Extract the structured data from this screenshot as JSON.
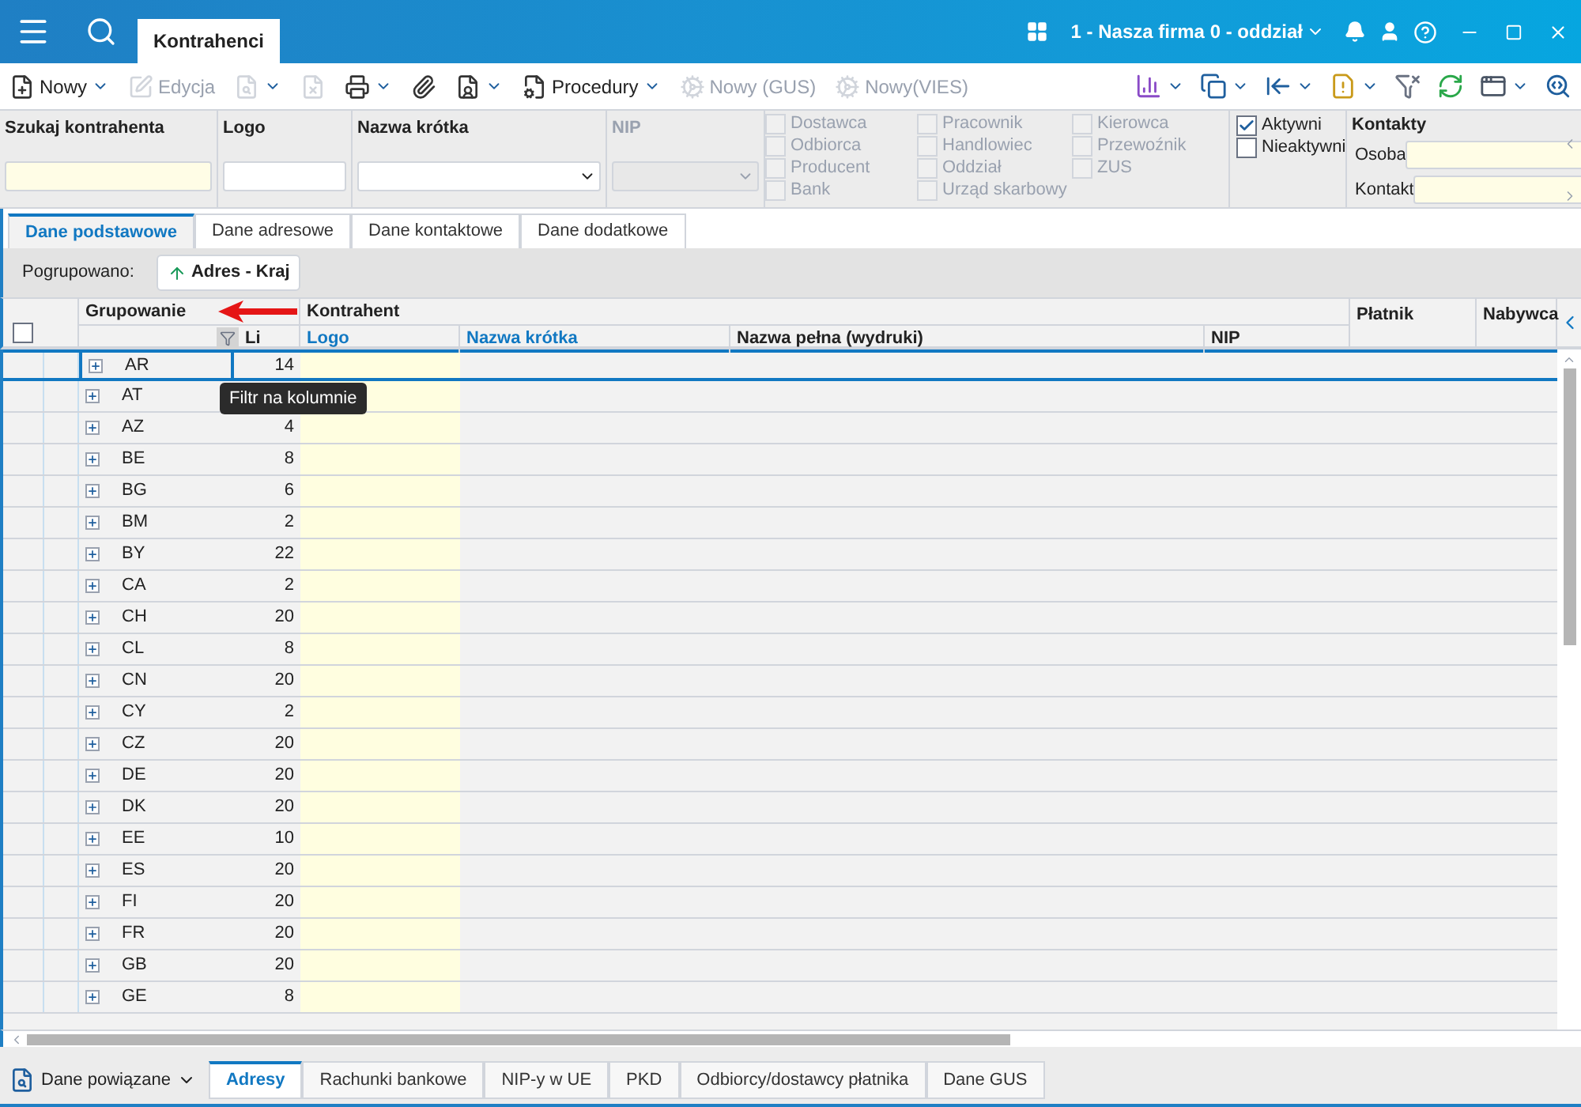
{
  "title_bar": {
    "tab": "Kontrahenci",
    "company": "1 - Nasza firma 0 - oddział"
  },
  "toolbar": {
    "left": [
      {
        "label": "Nowy",
        "caret": true,
        "disabled": false
      },
      {
        "label": "Edycja",
        "caret": false,
        "disabled": true
      },
      {
        "caret": true,
        "disabled": true
      },
      {
        "caret": false,
        "disabled": true
      },
      {
        "caret": true,
        "disabled": false
      },
      {
        "caret": false,
        "disabled": false
      },
      {
        "caret": true,
        "disabled": false
      },
      {
        "label": "Procedury",
        "caret": true,
        "disabled": false
      },
      {
        "label": "Nowy (GUS)",
        "caret": false,
        "disabled": true
      },
      {
        "label": "Nowy(VIES)",
        "caret": false,
        "disabled": true
      }
    ],
    "right": [
      {
        "caret": true
      },
      {
        "caret": true
      },
      {
        "caret": true
      },
      {
        "caret": true
      },
      {
        "caret": false
      },
      {
        "caret": false
      },
      {
        "caret": true
      },
      {
        "caret": false
      }
    ]
  },
  "filters": {
    "search": {
      "label": "Szukaj kontrahenta"
    },
    "logo": {
      "label": "Logo"
    },
    "short_name": {
      "label": "Nazwa krótka"
    },
    "nip": {
      "label": "NIP",
      "disabled": true
    },
    "role_columns": [
      [
        {
          "label": "Dostawca",
          "checked": false,
          "disabled": true
        },
        {
          "label": "Odbiorca",
          "checked": false,
          "disabled": true
        },
        {
          "label": "Producent",
          "checked": false,
          "disabled": true
        },
        {
          "label": "Bank",
          "checked": false,
          "disabled": true
        }
      ],
      [
        {
          "label": "Pracownik",
          "checked": false,
          "disabled": true
        },
        {
          "label": "Handlowiec",
          "checked": false,
          "disabled": true
        },
        {
          "label": "Oddział",
          "checked": false,
          "disabled": true
        },
        {
          "label": "Urząd skarbowy",
          "checked": false,
          "disabled": true
        }
      ],
      [
        {
          "label": "Kierowca",
          "checked": false,
          "disabled": true
        },
        {
          "label": "Przewoźnik",
          "checked": false,
          "disabled": true
        },
        {
          "label": "ZUS",
          "checked": false,
          "disabled": true
        }
      ]
    ],
    "status": [
      {
        "label": "Aktywni",
        "checked": true
      },
      {
        "label": "Nieaktywni",
        "checked": false
      }
    ],
    "contacts": {
      "title": "Kontakty",
      "fields": [
        {
          "label": "Osoba"
        },
        {
          "label": "Kontakt"
        }
      ]
    }
  },
  "tabs": [
    {
      "label": "Dane podstawowe",
      "selected": true
    },
    {
      "label": "Dane adresowe",
      "selected": false
    },
    {
      "label": "Dane kontaktowe",
      "selected": false
    },
    {
      "label": "Dane dodatkowe",
      "selected": false
    }
  ],
  "grouping": {
    "label": "Pogrupowano:",
    "chip": "Adres - Kraj"
  },
  "grid": {
    "select_all_checked": false,
    "group_header": "Grupowanie",
    "count_header": "Li",
    "contractor_header": "Kontrahent",
    "columns": [
      {
        "label": "Logo"
      },
      {
        "label": "Nazwa krótka"
      },
      {
        "label": "Nazwa pełna (wydruki)"
      },
      {
        "label": "NIP"
      }
    ],
    "extra_columns": [
      {
        "label": "Płatnik"
      },
      {
        "label": "Nabywca"
      }
    ],
    "rows": [
      {
        "code": "AR",
        "count": "14",
        "selected": true
      },
      {
        "code": "AT",
        "selected": false
      },
      {
        "code": "AZ",
        "count": "4",
        "selected": false
      },
      {
        "code": "BE",
        "count": "8",
        "selected": false
      },
      {
        "code": "BG",
        "count": "6",
        "selected": false
      },
      {
        "code": "BM",
        "count": "2",
        "selected": false
      },
      {
        "code": "BY",
        "count": "22",
        "selected": false
      },
      {
        "code": "CA",
        "count": "2",
        "selected": false
      },
      {
        "code": "CH",
        "count": "20",
        "selected": false
      },
      {
        "code": "CL",
        "count": "8",
        "selected": false
      },
      {
        "code": "CN",
        "count": "20",
        "selected": false
      },
      {
        "code": "CY",
        "count": "2",
        "selected": false
      },
      {
        "code": "CZ",
        "count": "20",
        "selected": false
      },
      {
        "code": "DE",
        "count": "20",
        "selected": false
      },
      {
        "code": "DK",
        "count": "20",
        "selected": false
      },
      {
        "code": "EE",
        "count": "10",
        "selected": false
      },
      {
        "code": "ES",
        "count": "20",
        "selected": false
      },
      {
        "code": "FI",
        "count": "20",
        "selected": false
      },
      {
        "code": "FR",
        "count": "20",
        "selected": false
      },
      {
        "code": "GB",
        "count": "20",
        "selected": false
      },
      {
        "code": "GE",
        "count": "8",
        "selected": false
      }
    ]
  },
  "tooltip": "Filtr na kolumnie",
  "bottom": {
    "dropdown": "Dane powiązane",
    "tabs": [
      {
        "label": "Adresy",
        "selected": true
      },
      {
        "label": "Rachunki bankowe",
        "selected": false
      },
      {
        "label": "NIP-y w UE",
        "selected": false
      },
      {
        "label": "PKD",
        "selected": false
      },
      {
        "label": "Odbiorcy/dostawcy płatnika",
        "selected": false
      },
      {
        "label": "Dane GUS",
        "selected": false
      }
    ]
  }
}
